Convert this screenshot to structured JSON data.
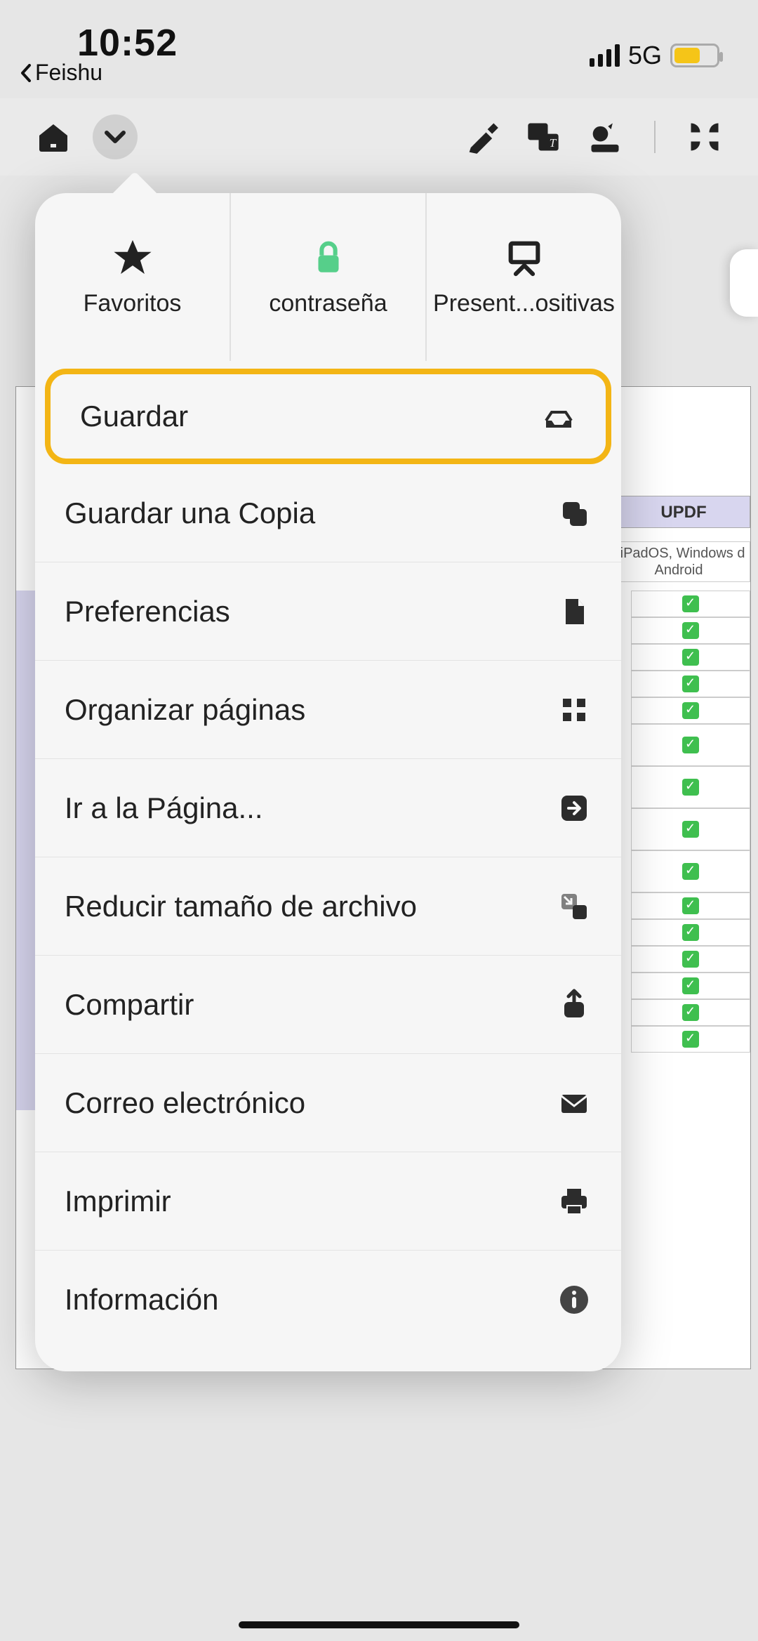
{
  "status": {
    "time": "10:52",
    "back_app": "Feishu",
    "network": "5G"
  },
  "bg_doc": {
    "column_header": "UPDF",
    "column_sub": ", iPadOS, Windows d Android"
  },
  "popover": {
    "top": {
      "favorites": "Favoritos",
      "password": "contraseña",
      "slideshow": "Present...ositivas"
    },
    "items": {
      "save": "Guardar",
      "save_copy": "Guardar una Copia",
      "preferences": "Preferencias",
      "organize": "Organizar páginas",
      "goto": "Ir a la Página...",
      "reduce": "Reducir tamaño de archivo",
      "share": "Compartir",
      "email": "Correo electrónico",
      "print": "Imprimir",
      "info": "Información"
    }
  }
}
